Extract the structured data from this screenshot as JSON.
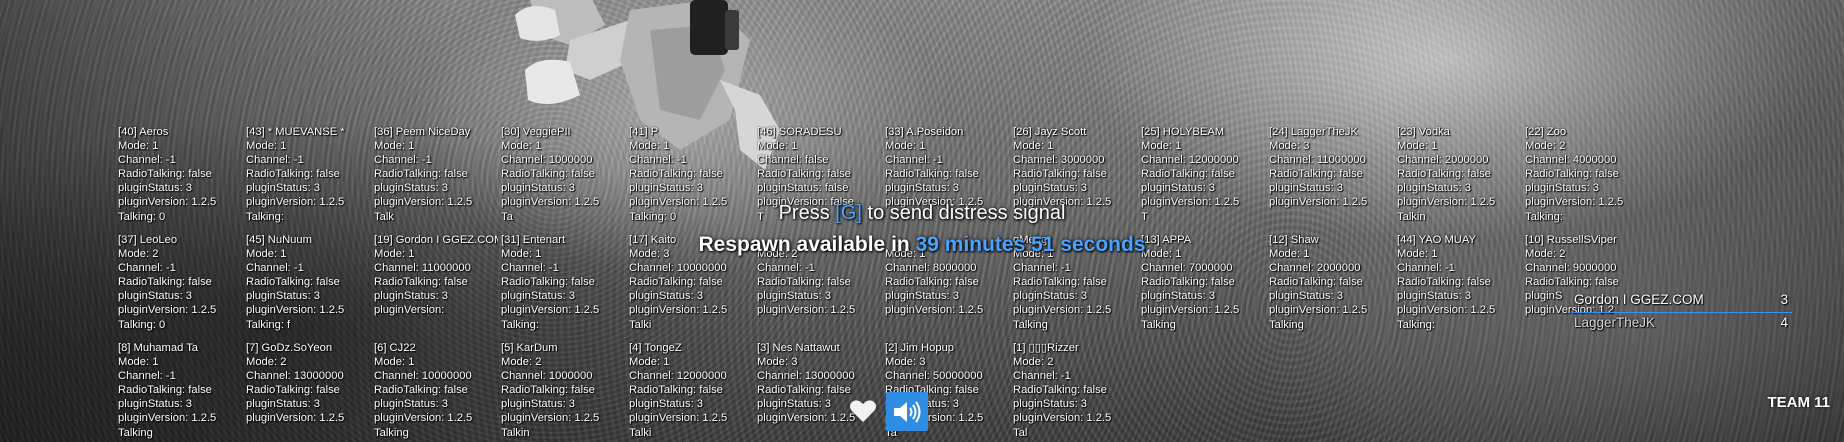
{
  "players": [
    {
      "lines": [
        "[40] Aeros",
        "Mode: 1",
        "Channel: -1",
        "RadioTalking: false",
        "pluginStatus: 3",
        "pluginVersion: 1.2.5",
        "Talking: 0"
      ]
    },
    {
      "lines": [
        "[43] * MUEVANSE *",
        "Mode: 1",
        "Channel: -1",
        "RadioTalking: false",
        "pluginStatus: 3",
        "pluginVersion: 1.2.5",
        "Talking:"
      ]
    },
    {
      "lines": [
        "[36] Peem NiceDay",
        "Mode: 1",
        "Channel: -1",
        "RadioTalking: false",
        "pluginStatus: 3",
        "pluginVersion: 1.2.5",
        "Talk"
      ]
    },
    {
      "lines": [
        "[30] VeggiePII",
        "Mode: 1",
        "Channel: 1000000",
        "RadioTalking: false",
        "pluginStatus: 3",
        "pluginVersion: 1.2.5",
        "Ta"
      ]
    },
    {
      "lines": [
        "[41] P",
        "Mode: 1",
        "Channel: -1",
        "RadioTalking: false",
        "pluginStatus: 3",
        "pluginVersion: 1.2.5",
        "Talking: 0"
      ]
    },
    {
      "lines": [
        "[46] SORADESU",
        "Mode: 1",
        "Channel: false",
        "RadioTalking: false",
        "pluginStatus: false",
        "pluginVersion: false",
        "T"
      ]
    },
    {
      "lines": [
        "[33] A.Poseidon",
        "Mode: 1",
        "Channel: -1",
        "RadioTalking: false",
        "pluginStatus: 3",
        "pluginVersion: 1.2.5",
        ""
      ]
    },
    {
      "lines": [
        "[26] Jayz Scott",
        "Mode: 1",
        "Channel: 3000000",
        "RadioTalking: false",
        "pluginStatus: 3",
        "pluginVersion: 1.2.5",
        "T"
      ]
    },
    {
      "lines": [
        "[25] HOLYBEAM",
        "Mode: 1",
        "Channel: 12000000",
        "RadioTalking: false",
        "pluginStatus: 3",
        "pluginVersion: 1.2.5",
        "T"
      ]
    },
    {
      "lines": [
        "[24] LaggerTheJK",
        "Mode: 3",
        "Channel: 11000000",
        "RadioTalking: false",
        "pluginStatus: 3",
        "pluginVersion: 1.2.5",
        ""
      ]
    },
    {
      "lines": [
        "[23] Vodka",
        "Mode: 1",
        "Channel: 2000000",
        "RadioTalking: false",
        "pluginStatus: 3",
        "pluginVersion: 1.2.5",
        "Talkin"
      ]
    },
    {
      "lines": [
        "[22] Zoo",
        "Mode: 2",
        "Channel: 4000000",
        "RadioTalking: false",
        "pluginStatus: 3",
        "pluginVersion: 1.2.5",
        "Talking:"
      ]
    },
    {
      "lines": [
        "[37] LeoLeo",
        "Mode: 2",
        "Channel: -1",
        "RadioTalking: false",
        "pluginStatus: 3",
        "pluginVersion: 1.2.5",
        "Talking: 0"
      ]
    },
    {
      "lines": [
        "[45] NuNuum",
        "Mode: 1",
        "Channel: -1",
        "RadioTalking: false",
        "pluginStatus: 3",
        "pluginVersion: 1.2.5",
        "Talking: f"
      ]
    },
    {
      "lines": [
        "[19] Gordon I GGEZ.COM",
        "Mode: 1",
        "Channel: 11000000",
        "RadioTalking: false",
        "pluginStatus: 3",
        "pluginVersion:",
        ""
      ]
    },
    {
      "lines": [
        "[31] Entenart",
        "Mode: 1",
        "Channel: -1",
        "RadioTalking: false",
        "pluginStatus: 3",
        "pluginVersion: 1.2.5",
        "Talking:"
      ]
    },
    {
      "lines": [
        "[17] Kaito",
        "Mode: 3",
        "Channel: 10000000",
        "RadioTalking: false",
        "pluginStatus: 3",
        "pluginVersion: 1.2.5",
        "Talki"
      ]
    },
    {
      "lines": [
        "",
        "Mode: 2",
        "Channel: -1",
        "RadioTalking: false",
        "pluginStatus: 3",
        "pluginVersion: 1.2.5",
        ""
      ]
    },
    {
      "lines": [
        "",
        "Mode: 1",
        "Channel: 8000000",
        "RadioTalking: false",
        "pluginStatus: 3",
        "pluginVersion: 1.2.5",
        ""
      ]
    },
    {
      "lines": [
        "gMeng",
        "Mode: 1",
        "Channel: -1",
        "RadioTalking: false",
        "pluginStatus: 3",
        "pluginVersion: 1.2.5",
        "Talking"
      ]
    },
    {
      "lines": [
        "[13] APPA",
        "Mode: 1",
        "Channel: 7000000",
        "RadioTalking: false",
        "pluginStatus: 3",
        "pluginVersion: 1.2.5",
        "Talking"
      ]
    },
    {
      "lines": [
        "[12] Shaw",
        "Mode: 1",
        "Channel: 2000000",
        "RadioTalking: false",
        "pluginStatus: 3",
        "pluginVersion: 1.2.5",
        "Talking"
      ]
    },
    {
      "lines": [
        "[44] YAO MUAY",
        "Mode: 1",
        "Channel: -1",
        "RadioTalking: false",
        "pluginStatus: 3",
        "pluginVersion: 1.2.5",
        "Talking:"
      ]
    },
    {
      "lines": [
        "[10] RussellSViper",
        "Mode: 2",
        "Channel: 9000000",
        "RadioTalking: false",
        "pluginS",
        "pluginVersion: 1.2",
        ""
      ]
    },
    {
      "lines": [
        "[8] Muhamad Ta",
        "Mode: 1",
        "Channel: -1",
        "RadioTalking: false",
        "pluginStatus: 3",
        "pluginVersion: 1.2.5",
        "Talking"
      ]
    },
    {
      "lines": [
        "[7] GoDz.SoYeon",
        "Mode: 2",
        "Channel: 13000000",
        "RadioTalking: false",
        "pluginStatus: 3",
        "pluginVersion: 1.2.5",
        ""
      ]
    },
    {
      "lines": [
        "[6] CJ22",
        "Mode: 1",
        "Channel: 10000000",
        "RadioTalking: false",
        "pluginStatus: 3",
        "pluginVersion: 1.2.5",
        "Talking"
      ]
    },
    {
      "lines": [
        "[5] KarDum",
        "Mode: 2",
        "Channel: 1000000",
        "RadioTalking: false",
        "pluginStatus: 3",
        "pluginVersion: 1.2.5",
        "Talkin"
      ]
    },
    {
      "lines": [
        "[4] TongeZ",
        "Mode: 1",
        "Channel: 12000000",
        "RadioTalking: false",
        "pluginStatus: 3",
        "pluginVersion: 1.2.5",
        "Talki"
      ]
    },
    {
      "lines": [
        "[3] Nes Nattawut",
        "Mode: 3",
        "Channel: 13000000",
        "RadioTalking: false",
        "pluginStatus: 3",
        "pluginVersion: 1.2.5",
        ""
      ]
    },
    {
      "lines": [
        "[2] Jim Hopup",
        "Mode: 3",
        "Channel: 50000000",
        "RadioTalking: false",
        "pluginStatus: 3",
        "pluginVersion: 1.2.5",
        "Ta"
      ]
    },
    {
      "lines": [
        "[1] ▯▯▯Rizzer",
        "Mode: 2",
        "Channel: -1",
        "RadioTalking: false",
        "pluginStatus: 3",
        "pluginVersion: 1.2.5",
        "Tal"
      ]
    }
  ],
  "respawn": {
    "distress_prefix": "Press ",
    "distress_key": "[G]",
    "distress_suffix": " to send distress signal",
    "respawn_prefix": "Respawn available in ",
    "respawn_time": "39 minutes 51 seconds"
  },
  "scoreboard": {
    "rows": [
      {
        "name": "Gordon I GGEZ.COM",
        "score": "3"
      },
      {
        "name": "LaggerTheJK",
        "score": "4"
      }
    ],
    "team_label": "TEAM 11"
  },
  "icons": {
    "heart": "heart-icon",
    "speaker": "speaker-icon"
  },
  "colors": {
    "accent": "#2f8de4",
    "highlight_text": "#4aa3ff",
    "text": "#ffffff"
  }
}
